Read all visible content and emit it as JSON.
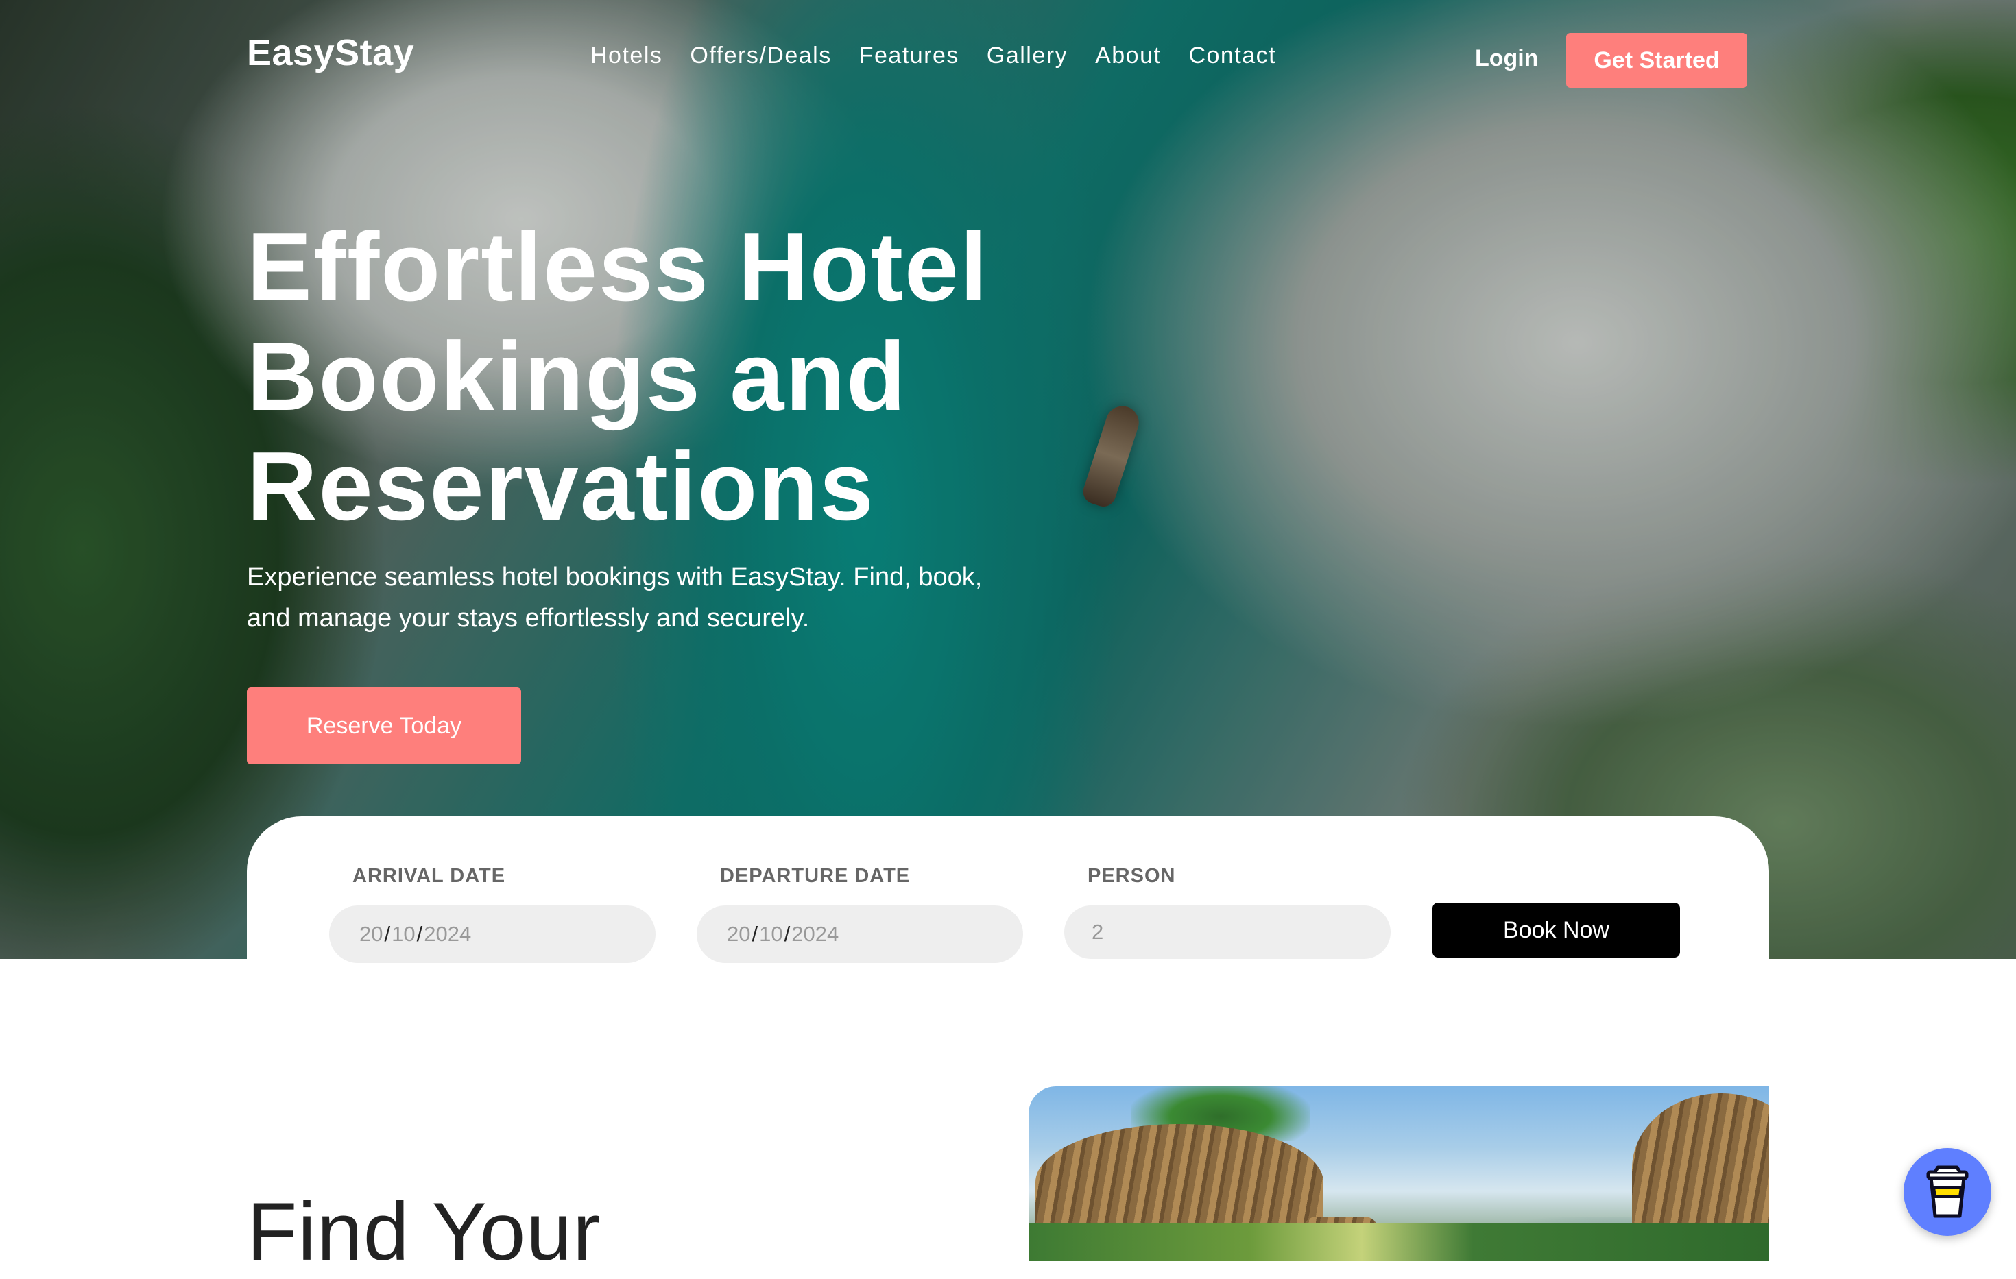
{
  "brand": {
    "name": "EasyStay",
    "accent": "#fe7f7c"
  },
  "nav": {
    "items": [
      {
        "label": "Hotels"
      },
      {
        "label": "Offers/Deals"
      },
      {
        "label": "Features"
      },
      {
        "label": "Gallery"
      },
      {
        "label": "About"
      },
      {
        "label": "Contact"
      }
    ],
    "login_label": "Login",
    "cta_label": "Get Started"
  },
  "hero": {
    "title": "Effortless Hotel Bookings and Reservations",
    "subtitle": "Experience seamless hotel bookings with EasyStay. Find, book, and manage your stays effortlessly and securely.",
    "cta_label": "Reserve Today"
  },
  "booking": {
    "arrival": {
      "label": "ARRIVAL DATE",
      "day": "20",
      "month": "10",
      "year": "2024"
    },
    "departure": {
      "label": "DEPARTURE DATE",
      "day": "20",
      "month": "10",
      "year": "2024"
    },
    "person": {
      "label": "PERSON",
      "value": "2"
    },
    "submit_label": "Book Now"
  },
  "section": {
    "title": "Find Your"
  },
  "widget": {
    "icon": "coffee-cup-icon",
    "color": "#5f7fff"
  }
}
